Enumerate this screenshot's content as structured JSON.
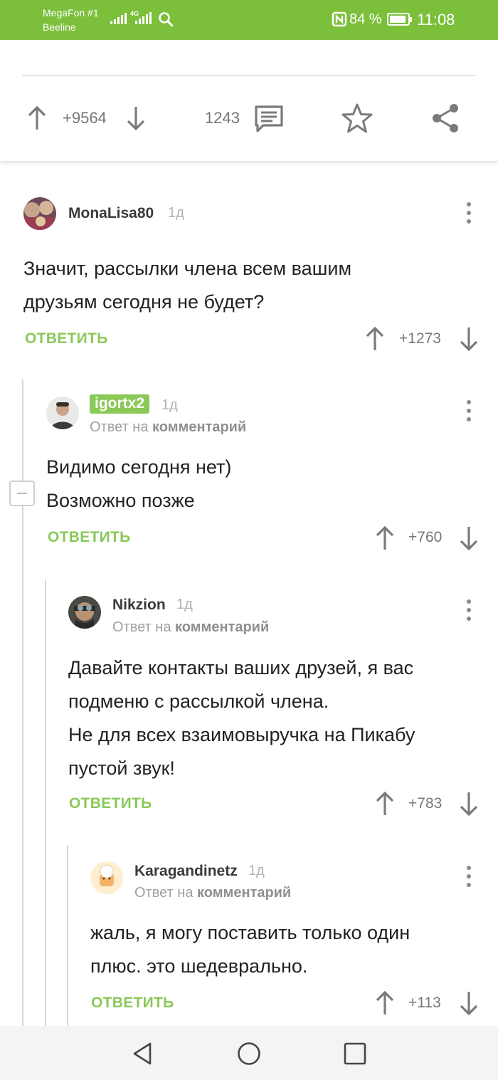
{
  "status_bar": {
    "carrier_1": "MegaFon #1",
    "carrier_2": "Beeline",
    "network": "4G",
    "battery": "84 %",
    "time": "11:08"
  },
  "post": {
    "rating": "+9564",
    "comments_count": "1243"
  },
  "comments": [
    {
      "author": "MonaLisa80",
      "time": "1д",
      "text_lines": [
        "Значит, рассылки члена всем вашим",
        "друзьям сегодня не будет?"
      ],
      "reply_label": "ОТВЕТИТЬ",
      "rating": "+1273"
    },
    {
      "author": "igortx2",
      "time": "1д",
      "reply_to_prefix": "Ответ на",
      "reply_to_target": "комментарий",
      "text_lines": [
        "Видимо сегодня нет)",
        "Возможно позже"
      ],
      "reply_label": "ОТВЕТИТЬ",
      "rating": "+760"
    },
    {
      "author": "Nikzion",
      "time": "1д",
      "reply_to_prefix": "Ответ на",
      "reply_to_target": "комментарий",
      "text_lines": [
        "Давайте контакты ваших друзей, я вас",
        "подменю с рассылкой члена.",
        "Не для всех взаимовыручка на Пикабу",
        "пустой звук!"
      ],
      "reply_label": "ОТВЕТИТЬ",
      "rating": "+783"
    },
    {
      "author": "Karagandinetz",
      "time": "1д",
      "reply_to_prefix": "Ответ на",
      "reply_to_target": "комментарий",
      "text_lines": [
        "жаль, я могу поставить только один",
        "плюс. это шедеврально."
      ],
      "reply_label": "ОТВЕТИТЬ",
      "rating": "+113"
    }
  ],
  "colors": {
    "accent_green": "#8ac858",
    "status_bar": "#7cbf3b"
  },
  "icons": [
    "signal-icon",
    "search-icon",
    "nfc-icon",
    "battery-icon",
    "upvote-icon",
    "downvote-icon",
    "comments-icon",
    "star-icon",
    "share-icon",
    "more-vert-icon",
    "collapse-icon",
    "back-icon",
    "home-icon",
    "recents-icon"
  ]
}
